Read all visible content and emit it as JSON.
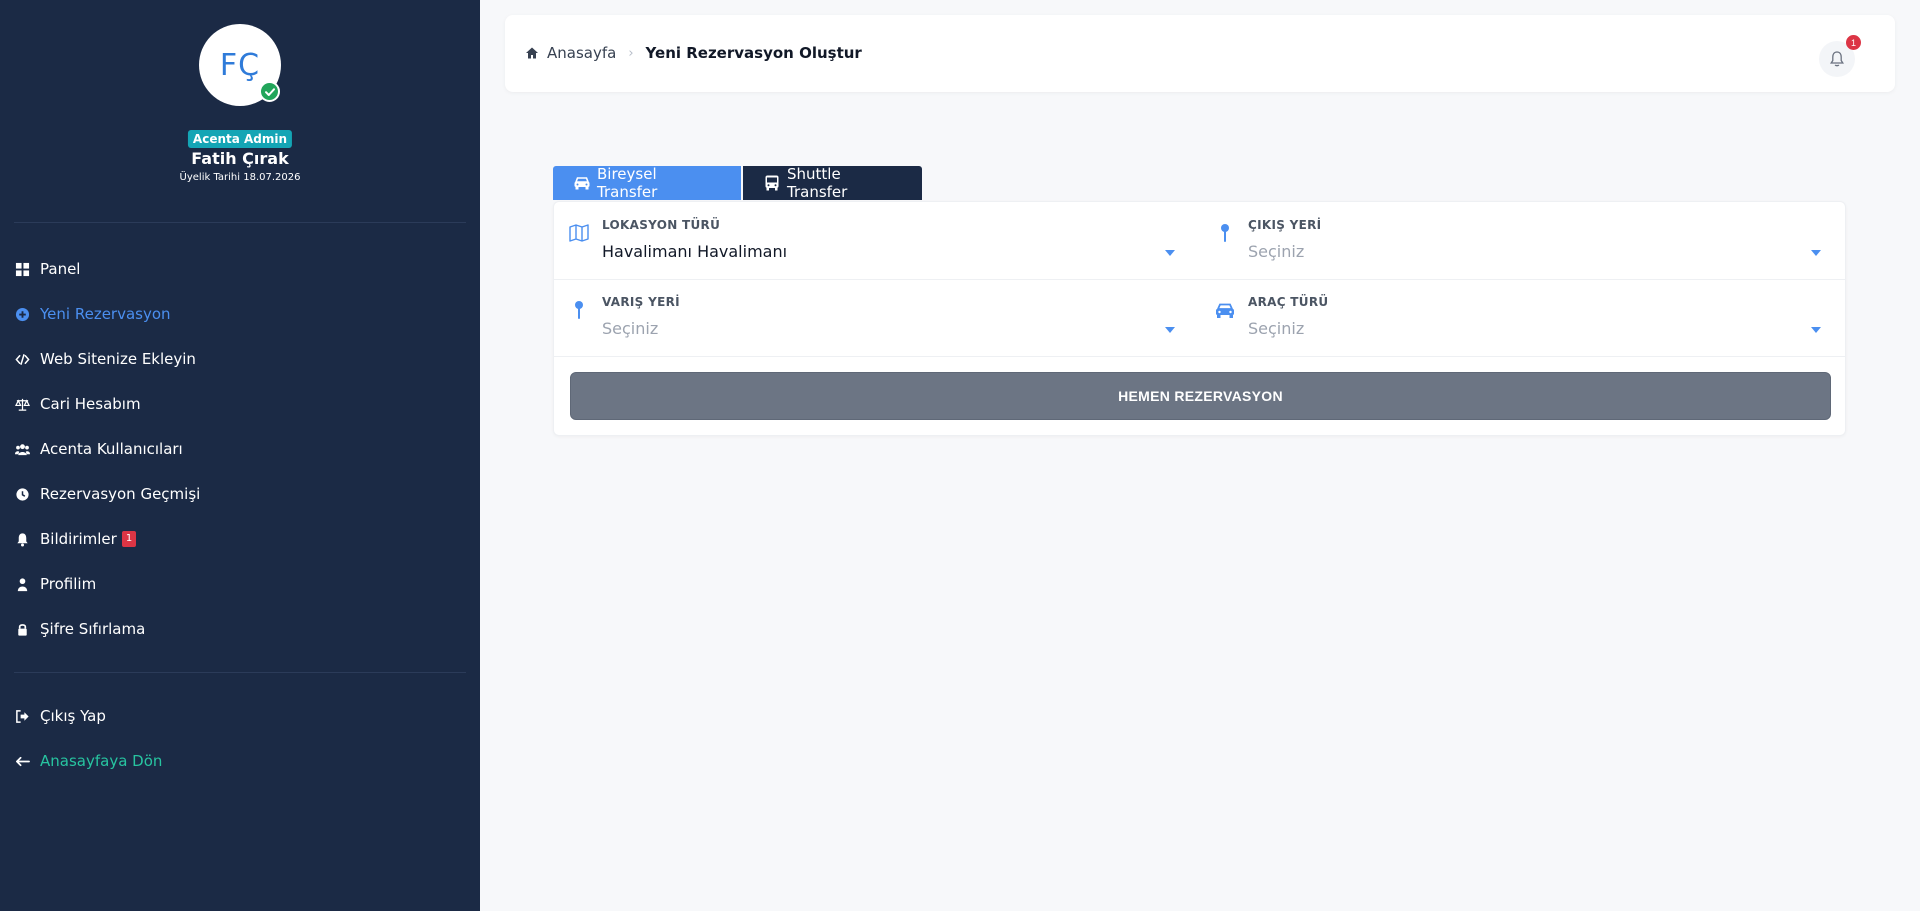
{
  "sidebar": {
    "avatar_initials": "FÇ",
    "role_badge": "Acenta Admin",
    "user_name": "Fatih Çırak",
    "member_since": "Üyelik Tarihi 18.07.2026",
    "nav": [
      {
        "label": "Panel",
        "icon": "grid-icon"
      },
      {
        "label": "Yeni Rezervasyon",
        "icon": "plus-circle-icon",
        "active": true
      },
      {
        "label": "Web Sitenize Ekleyin",
        "icon": "code-icon"
      },
      {
        "label": "Cari Hesabım",
        "icon": "balance-scale-icon"
      },
      {
        "label": "Acenta Kullanıcıları",
        "icon": "users-icon"
      },
      {
        "label": "Rezervasyon Geçmişi",
        "icon": "clock-icon"
      },
      {
        "label": "Bildirimler",
        "icon": "bell-icon",
        "badge": "1"
      },
      {
        "label": "Profilim",
        "icon": "user-icon"
      },
      {
        "label": "Şifre Sıfırlama",
        "icon": "lock-icon"
      }
    ],
    "bottom_nav": [
      {
        "label": "Çıkış Yap",
        "icon": "sign-out-icon"
      },
      {
        "label": "Anasayfaya Dön",
        "icon": "arrow-left-icon"
      }
    ]
  },
  "header": {
    "breadcrumb_home": "Anasayfa",
    "breadcrumb_separator": "›",
    "breadcrumb_current": "Yeni Rezervasyon Oluştur",
    "notification_count": "1"
  },
  "tabs": [
    {
      "label": "Bireysel Transfer",
      "icon": "car-icon",
      "active": true
    },
    {
      "label": "Shuttle Transfer",
      "icon": "bus-icon"
    }
  ],
  "form": {
    "location_type": {
      "label": "LOKASYON TÜRÜ",
      "value": "Havalimanı Havalimanı",
      "icon": "map-icon"
    },
    "departure": {
      "label": "ÇIKIŞ YERİ",
      "placeholder": "Seçiniz",
      "icon": "map-pin-icon"
    },
    "arrival": {
      "label": "VARIŞ YERİ",
      "placeholder": "Seçiniz",
      "icon": "map-pin-icon"
    },
    "vehicle_type": {
      "label": "ARAÇ TÜRÜ",
      "placeholder": "Seçiniz",
      "icon": "car-icon"
    },
    "submit_label": "HEMEN REZERVASYON"
  },
  "colors": {
    "sidebar_bg": "#1b2a45",
    "accent_blue": "#4b8ff0",
    "home_link": "#27c4a0",
    "role_badge": "#14a5b5",
    "danger": "#dc3545",
    "submit_bg": "#6c7584"
  }
}
